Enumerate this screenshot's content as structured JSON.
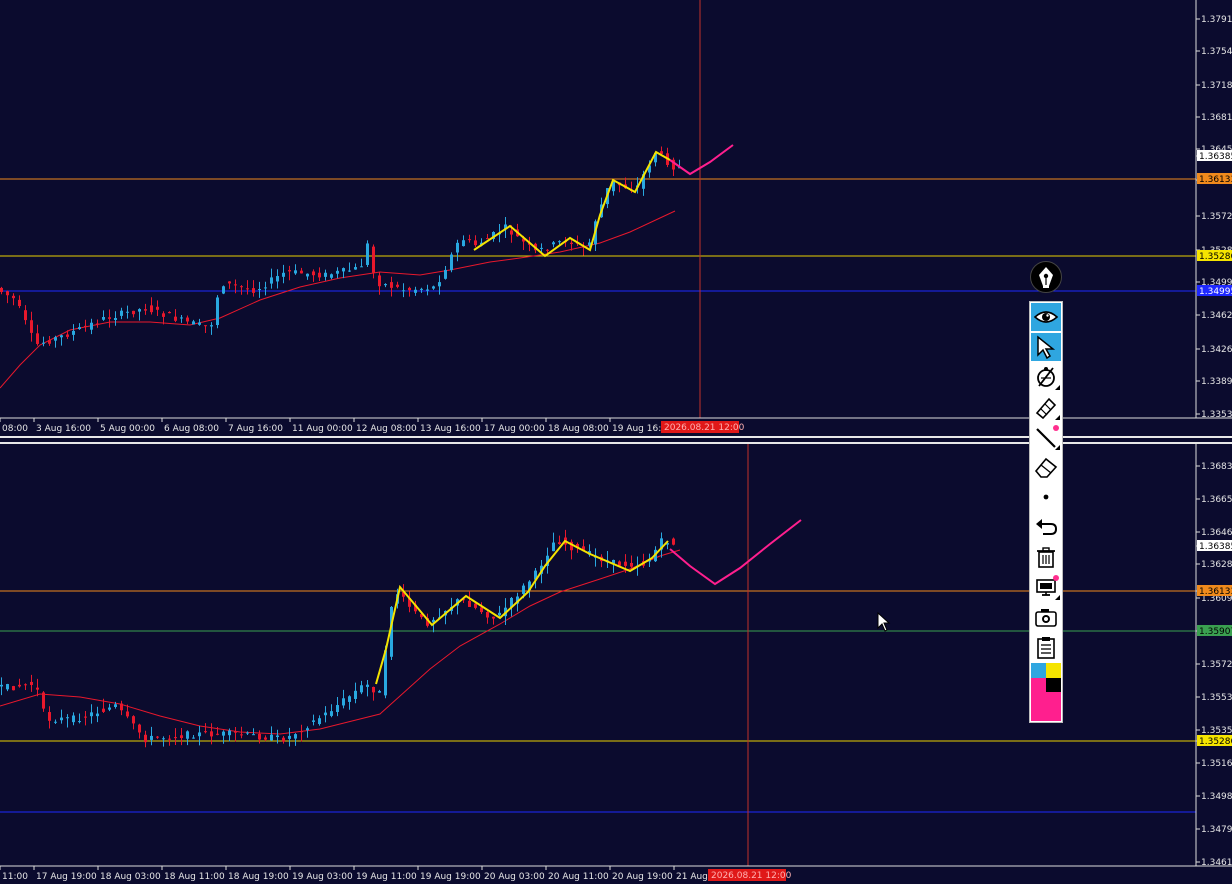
{
  "colors": {
    "background": "#0b0b2e",
    "bull_candle": "#29a8e0",
    "bear_candle": "#e8182c",
    "ma_line": "#e8182c",
    "zigzag": "#f5e400",
    "projection": "#ff1f8e",
    "orange_level": "#f08a1c",
    "yellow_level": "#e8d000",
    "blue_level": "#1e28ff",
    "green_level": "#3aa050",
    "crosshair": "#c0302a"
  },
  "top_chart": {
    "price_labels": [
      "1.37915",
      "1.37545",
      "1.37185",
      "1.36815",
      "1.36455",
      "1.36385",
      "1.36133",
      "1.35725",
      "1.35285",
      "1.34995",
      "1.34625",
      "1.34265",
      "1.33895",
      "1.33535"
    ],
    "tag_labels": [
      "1.36385",
      "1.36133",
      "1.35286",
      "1.34995"
    ],
    "time_labels": [
      "08:00",
      "3 Aug 16:00",
      "5 Aug 00:00",
      "6 Aug 08:00",
      "7 Aug 16:00",
      "11 Aug 00:00",
      "12 Aug 08:00",
      "13 Aug 16:00",
      "17 Aug 00:00",
      "18 Aug 08:00",
      "19 Aug 16:00"
    ],
    "crosshair_time": "2026.08.21 12:00"
  },
  "bottom_chart": {
    "price_labels": [
      "1.36835",
      "1.36650",
      "1.36465",
      "1.36385",
      "1.36280",
      "1.36133",
      "1.36095",
      "1.35907",
      "1.35720",
      "1.35535",
      "1.35350",
      "1.35286",
      "1.35165",
      "1.34980",
      "1.34795",
      "1.34610"
    ],
    "tag_labels": [
      "1.36385",
      "1.36133",
      "1.35907",
      "1.35286"
    ],
    "time_labels": [
      "11:00",
      "17 Aug 19:00",
      "18 Aug 03:00",
      "18 Aug 11:00",
      "18 Aug 19:00",
      "19 Aug 03:00",
      "19 Aug 11:00",
      "19 Aug 19:00",
      "20 Aug 03:00",
      "20 Aug 11:00",
      "20 Aug 19:00",
      "21 Aug"
    ],
    "crosshair_time": "2026.08.21 12:00"
  },
  "toolbar": {
    "items": [
      {
        "name": "eye-icon",
        "active": true
      },
      {
        "name": "cursor-arrow-icon",
        "active": true
      },
      {
        "name": "compass-icon",
        "active": false
      },
      {
        "name": "pencil-icon",
        "active": false
      },
      {
        "name": "line-icon",
        "active": false
      },
      {
        "name": "eraser-icon",
        "active": false
      },
      {
        "name": "dot-icon",
        "active": false
      },
      {
        "name": "undo-icon",
        "active": false
      },
      {
        "name": "trash-icon",
        "active": false
      },
      {
        "name": "monitor-icon",
        "active": false
      },
      {
        "name": "camera-icon",
        "active": false
      },
      {
        "name": "clipboard-icon",
        "active": false
      }
    ],
    "palette": [
      "#2fa6e0",
      "#f5e400",
      "#ff1f8e",
      "#000000"
    ]
  }
}
